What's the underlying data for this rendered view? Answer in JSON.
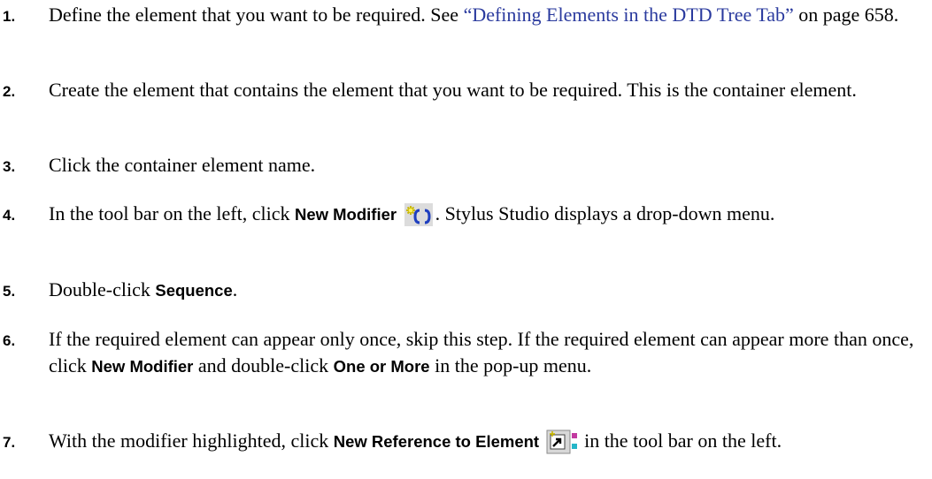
{
  "steps": [
    {
      "number": "1.",
      "text_before": "Define the element that you want to be required. See ",
      "link": "“Defining Elements in the DTD Tree Tab”",
      "text_after": " on page 658."
    },
    {
      "number": "2.",
      "text": "Create the element that contains the element that you want to be required. This is the container element."
    },
    {
      "number": "3.",
      "text": "Click the container element name."
    },
    {
      "number": "4.",
      "text_before": "In the tool bar on the left, click ",
      "ui_label": "New Modifier",
      "icon": "new-modifier-icon",
      "text_after": ". Stylus Studio displays a drop-down menu."
    },
    {
      "number": "5.",
      "text_before": "Double-click ",
      "ui_label": "Sequence",
      "text_after": "."
    },
    {
      "number": "6.",
      "text_before": "If the required element can appear only once, skip this step. If the required element can appear more than once, click ",
      "ui_label": "New Modifier",
      "text_middle": " and double-click ",
      "ui_label2": "One or More",
      "text_after": " in the pop-up menu."
    },
    {
      "number": "7.",
      "text_before": "With the modifier highlighted, click ",
      "ui_label": "New Reference to Element",
      "icon": "new-reference-to-element-icon",
      "text_after": " in the tool bar on the left."
    }
  ],
  "colors": {
    "link": "#2a3a9e",
    "text": "#000000",
    "background": "#ffffff"
  }
}
